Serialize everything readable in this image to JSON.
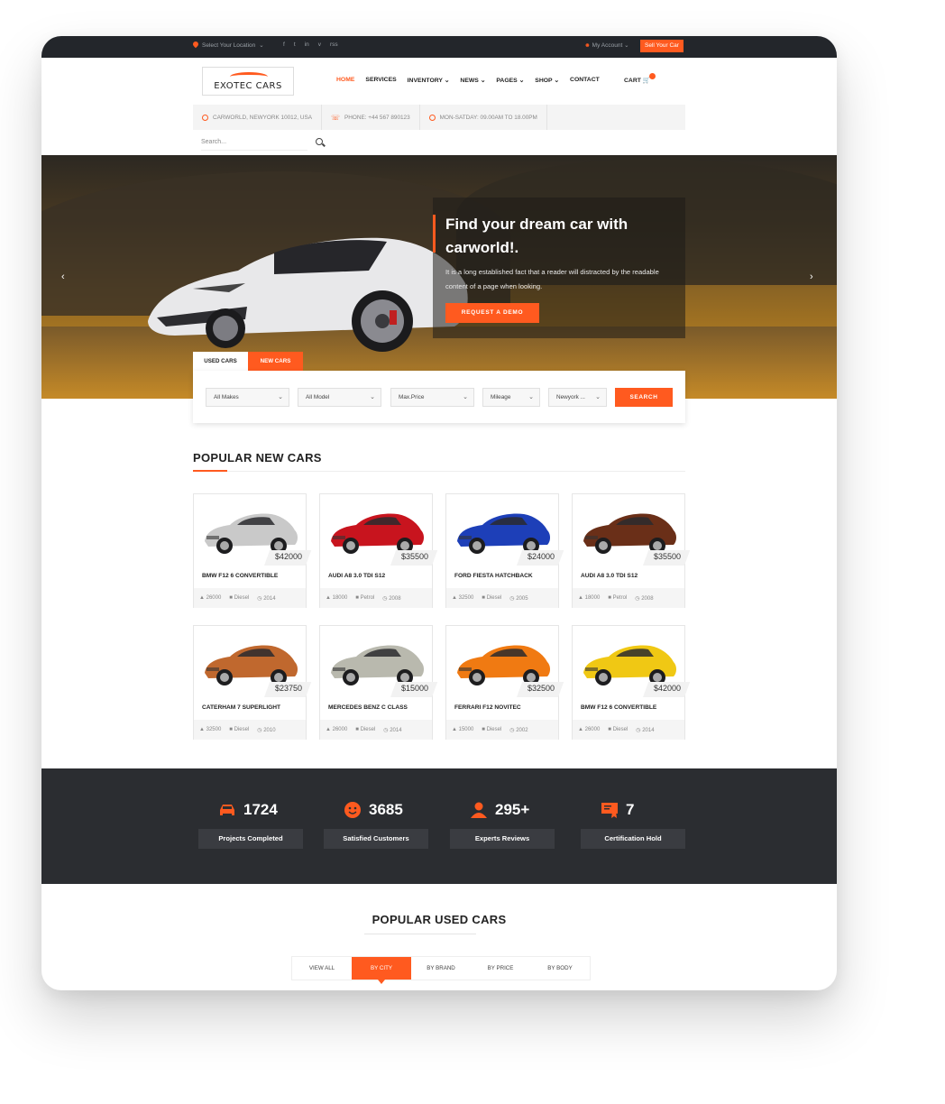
{
  "topbar": {
    "location": "Select Your Location",
    "social": [
      "f",
      "t",
      "in",
      "v",
      "rss"
    ],
    "account": "My Account",
    "sell_button": "Sell Your Car"
  },
  "header": {
    "logo_text": "EXOTEC CARS",
    "nav": [
      "HOME",
      "SERVICES",
      "INVENTORY",
      "NEWS",
      "PAGES",
      "SHOP",
      "CONTACT"
    ],
    "nav_dropdown_marks": [
      "",
      "",
      "⌄",
      "⌄",
      "⌄",
      "⌄",
      ""
    ],
    "cart": "CART"
  },
  "info": {
    "address": "CARWORLD, NEWYORK 10012, USA",
    "phone": "PHONE: +44 567 890123",
    "hours": "MON-SATDAY: 09.00AM TO 18.00PM"
  },
  "search": {
    "placeholder": "Search..."
  },
  "hero": {
    "title": "Find your dream car with carworld!.",
    "text": "It is a long established fact that a reader will distracted by the readable content of a page when looking.",
    "button": "REQUEST A DEMO",
    "prev": "‹",
    "next": "›"
  },
  "finder": {
    "tabs": [
      "USED CARS",
      "NEW CARS"
    ],
    "selects": [
      "All Makes",
      "All Model",
      "Max.Price",
      "Mileage",
      "Newyork ..."
    ],
    "button": "SEARCH"
  },
  "popular_new": {
    "title": "POPULAR NEW CARS",
    "cars": [
      {
        "name": "BMW F12 6 CONVERTIBLE",
        "price": "$42000",
        "km": "26000",
        "fuel": "Diesel",
        "year": "2014",
        "color": "#c9c9c9"
      },
      {
        "name": "AUDI A8 3.0 TDI S12",
        "price": "$35500",
        "km": "18000",
        "fuel": "Petrol",
        "year": "2008",
        "color": "#c8141e"
      },
      {
        "name": "FORD FIESTA HATCHBACK",
        "price": "$24000",
        "km": "32500",
        "fuel": "Diesel",
        "year": "2005",
        "color": "#1d3fb8"
      },
      {
        "name": "AUDI A8 3.0 TDI S12",
        "price": "$35500",
        "km": "18000",
        "fuel": "Petrol",
        "year": "2008",
        "color": "#6a2f18"
      },
      {
        "name": "CATERHAM 7 SUPERLIGHT",
        "price": "$23750",
        "km": "32500",
        "fuel": "Diesel",
        "year": "2010",
        "color": "#c0682e"
      },
      {
        "name": "MERCEDES BENZ C CLASS",
        "price": "$15000",
        "km": "26000",
        "fuel": "Diesel",
        "year": "2014",
        "color": "#b9b9ae"
      },
      {
        "name": "FERRARI F12 NOVITEC",
        "price": "$32500",
        "km": "15000",
        "fuel": "Diesel",
        "year": "2002",
        "color": "#f07a12"
      },
      {
        "name": "BMW F12 6 CONVERTIBLE",
        "price": "$42000",
        "km": "26000",
        "fuel": "Diesel",
        "year": "2014",
        "color": "#f0c814"
      }
    ]
  },
  "stats": [
    {
      "num": "1724",
      "label": "Projects Completed",
      "icon": "car-icon"
    },
    {
      "num": "3685",
      "label": "Satisfied Customers",
      "icon": "smile-icon"
    },
    {
      "num": "295+",
      "label": "Experts Reviews",
      "icon": "user-icon"
    },
    {
      "num": "7",
      "label": "Certification Hold",
      "icon": "certificate-icon"
    }
  ],
  "popular_used": {
    "title": "POPULAR USED CARS",
    "filters": [
      "VIEW ALL",
      "BY CITY",
      "BY BRAND",
      "BY PRICE",
      "BY BODY"
    ]
  },
  "colors": {
    "accent": "#ff5a1f",
    "dark": "#2b2d31"
  }
}
